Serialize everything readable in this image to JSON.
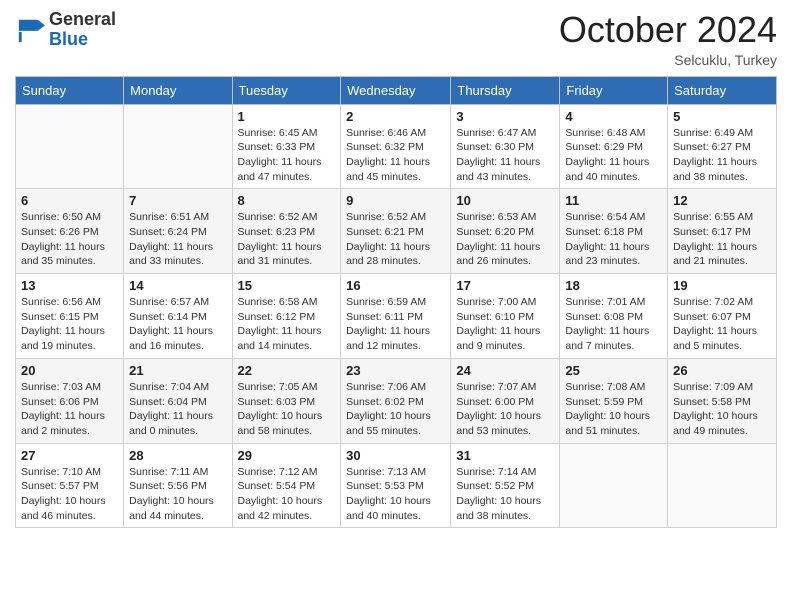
{
  "logo": {
    "general": "General",
    "blue": "Blue"
  },
  "header": {
    "month": "October 2024",
    "location": "Selcuklu, Turkey"
  },
  "days_of_week": [
    "Sunday",
    "Monday",
    "Tuesday",
    "Wednesday",
    "Thursday",
    "Friday",
    "Saturday"
  ],
  "weeks": [
    [
      {
        "day": "",
        "info": ""
      },
      {
        "day": "",
        "info": ""
      },
      {
        "day": "1",
        "info": "Sunrise: 6:45 AM\nSunset: 6:33 PM\nDaylight: 11 hours and 47 minutes."
      },
      {
        "day": "2",
        "info": "Sunrise: 6:46 AM\nSunset: 6:32 PM\nDaylight: 11 hours and 45 minutes."
      },
      {
        "day": "3",
        "info": "Sunrise: 6:47 AM\nSunset: 6:30 PM\nDaylight: 11 hours and 43 minutes."
      },
      {
        "day": "4",
        "info": "Sunrise: 6:48 AM\nSunset: 6:29 PM\nDaylight: 11 hours and 40 minutes."
      },
      {
        "day": "5",
        "info": "Sunrise: 6:49 AM\nSunset: 6:27 PM\nDaylight: 11 hours and 38 minutes."
      }
    ],
    [
      {
        "day": "6",
        "info": "Sunrise: 6:50 AM\nSunset: 6:26 PM\nDaylight: 11 hours and 35 minutes."
      },
      {
        "day": "7",
        "info": "Sunrise: 6:51 AM\nSunset: 6:24 PM\nDaylight: 11 hours and 33 minutes."
      },
      {
        "day": "8",
        "info": "Sunrise: 6:52 AM\nSunset: 6:23 PM\nDaylight: 11 hours and 31 minutes."
      },
      {
        "day": "9",
        "info": "Sunrise: 6:52 AM\nSunset: 6:21 PM\nDaylight: 11 hours and 28 minutes."
      },
      {
        "day": "10",
        "info": "Sunrise: 6:53 AM\nSunset: 6:20 PM\nDaylight: 11 hours and 26 minutes."
      },
      {
        "day": "11",
        "info": "Sunrise: 6:54 AM\nSunset: 6:18 PM\nDaylight: 11 hours and 23 minutes."
      },
      {
        "day": "12",
        "info": "Sunrise: 6:55 AM\nSunset: 6:17 PM\nDaylight: 11 hours and 21 minutes."
      }
    ],
    [
      {
        "day": "13",
        "info": "Sunrise: 6:56 AM\nSunset: 6:15 PM\nDaylight: 11 hours and 19 minutes."
      },
      {
        "day": "14",
        "info": "Sunrise: 6:57 AM\nSunset: 6:14 PM\nDaylight: 11 hours and 16 minutes."
      },
      {
        "day": "15",
        "info": "Sunrise: 6:58 AM\nSunset: 6:12 PM\nDaylight: 11 hours and 14 minutes."
      },
      {
        "day": "16",
        "info": "Sunrise: 6:59 AM\nSunset: 6:11 PM\nDaylight: 11 hours and 12 minutes."
      },
      {
        "day": "17",
        "info": "Sunrise: 7:00 AM\nSunset: 6:10 PM\nDaylight: 11 hours and 9 minutes."
      },
      {
        "day": "18",
        "info": "Sunrise: 7:01 AM\nSunset: 6:08 PM\nDaylight: 11 hours and 7 minutes."
      },
      {
        "day": "19",
        "info": "Sunrise: 7:02 AM\nSunset: 6:07 PM\nDaylight: 11 hours and 5 minutes."
      }
    ],
    [
      {
        "day": "20",
        "info": "Sunrise: 7:03 AM\nSunset: 6:06 PM\nDaylight: 11 hours and 2 minutes."
      },
      {
        "day": "21",
        "info": "Sunrise: 7:04 AM\nSunset: 6:04 PM\nDaylight: 11 hours and 0 minutes."
      },
      {
        "day": "22",
        "info": "Sunrise: 7:05 AM\nSunset: 6:03 PM\nDaylight: 10 hours and 58 minutes."
      },
      {
        "day": "23",
        "info": "Sunrise: 7:06 AM\nSunset: 6:02 PM\nDaylight: 10 hours and 55 minutes."
      },
      {
        "day": "24",
        "info": "Sunrise: 7:07 AM\nSunset: 6:00 PM\nDaylight: 10 hours and 53 minutes."
      },
      {
        "day": "25",
        "info": "Sunrise: 7:08 AM\nSunset: 5:59 PM\nDaylight: 10 hours and 51 minutes."
      },
      {
        "day": "26",
        "info": "Sunrise: 7:09 AM\nSunset: 5:58 PM\nDaylight: 10 hours and 49 minutes."
      }
    ],
    [
      {
        "day": "27",
        "info": "Sunrise: 7:10 AM\nSunset: 5:57 PM\nDaylight: 10 hours and 46 minutes."
      },
      {
        "day": "28",
        "info": "Sunrise: 7:11 AM\nSunset: 5:56 PM\nDaylight: 10 hours and 44 minutes."
      },
      {
        "day": "29",
        "info": "Sunrise: 7:12 AM\nSunset: 5:54 PM\nDaylight: 10 hours and 42 minutes."
      },
      {
        "day": "30",
        "info": "Sunrise: 7:13 AM\nSunset: 5:53 PM\nDaylight: 10 hours and 40 minutes."
      },
      {
        "day": "31",
        "info": "Sunrise: 7:14 AM\nSunset: 5:52 PM\nDaylight: 10 hours and 38 minutes."
      },
      {
        "day": "",
        "info": ""
      },
      {
        "day": "",
        "info": ""
      }
    ]
  ]
}
